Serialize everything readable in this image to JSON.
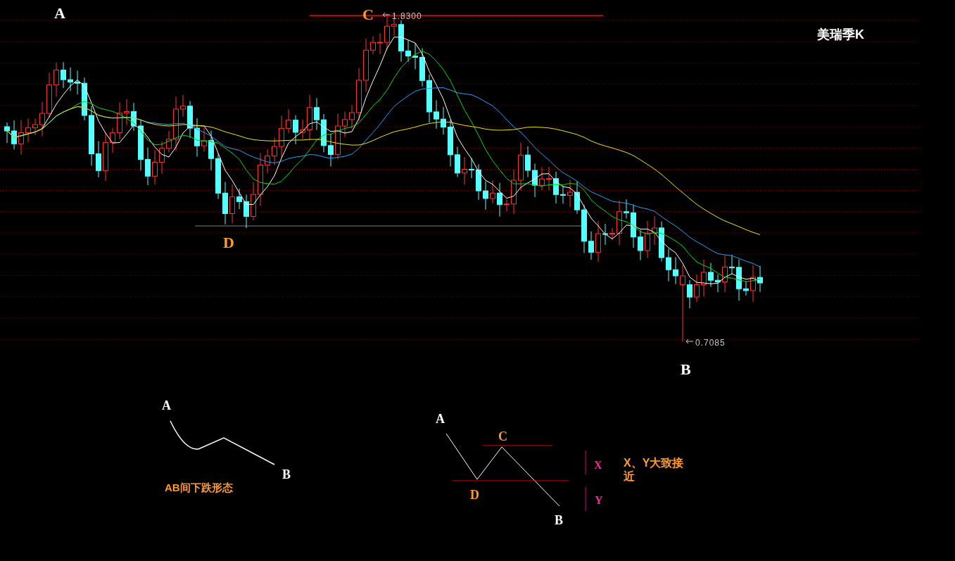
{
  "chart": {
    "title": "美瑞季K",
    "high_label": "1.8300",
    "low_label": "0.7085",
    "point_labels": [
      {
        "text": "A"
      },
      {
        "text": "C"
      },
      {
        "text": "D"
      },
      {
        "text": "B"
      }
    ]
  },
  "diagram_1": {
    "labels": [
      "A",
      "B"
    ],
    "caption": "AB间下跌形态"
  },
  "diagram_2": {
    "labels": [
      "A",
      "C",
      "D",
      "B"
    ],
    "x_label": "X",
    "y_label": "Y",
    "note": "X、Y大致接近"
  }
}
